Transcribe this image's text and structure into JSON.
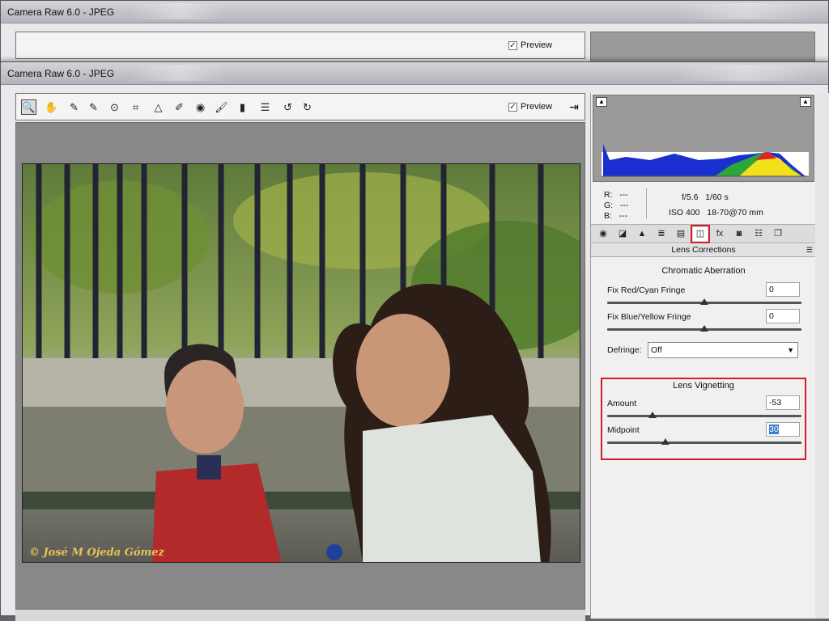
{
  "back_window": {
    "title": "Camera Raw 6.0  -  JPEG",
    "preview_label": "Preview",
    "preview_checked": true
  },
  "window": {
    "title": "Camera Raw 6.0  -  JPEG"
  },
  "toolbar": {
    "tools": [
      {
        "name": "zoom-tool-icon",
        "glyph": "🔍"
      },
      {
        "name": "hand-tool-icon",
        "glyph": "✋"
      },
      {
        "name": "white-balance-tool-icon",
        "glyph": "✎"
      },
      {
        "name": "color-sampler-tool-icon",
        "glyph": "✎"
      },
      {
        "name": "targeted-adjustment-tool-icon",
        "glyph": "⊙"
      },
      {
        "name": "crop-tool-icon",
        "glyph": "⌗"
      },
      {
        "name": "straighten-tool-icon",
        "glyph": "△"
      },
      {
        "name": "spot-removal-tool-icon",
        "glyph": "✐"
      },
      {
        "name": "red-eye-removal-tool-icon",
        "glyph": "◉"
      },
      {
        "name": "adjustment-brush-icon",
        "glyph": "🖌"
      },
      {
        "name": "graduated-filter-icon",
        "glyph": "▮"
      },
      {
        "name": "preferences-icon",
        "glyph": "☰"
      },
      {
        "name": "rotate-left-icon",
        "glyph": "↺"
      },
      {
        "name": "rotate-right-icon",
        "glyph": "↻"
      }
    ],
    "preview_label": "Preview",
    "preview_checked": true,
    "fullscreen_icon": "fullscreen-icon"
  },
  "photo": {
    "watermark": "© José M Ojeda Gómez"
  },
  "info": {
    "r": "R:   ---",
    "g": "G:   ---",
    "b": "B:   ---",
    "aperture": "f/5.6",
    "shutter": "1/60 s",
    "iso": "ISO 400",
    "lens": "18-70@70 mm"
  },
  "panel_tabs": [
    {
      "name": "tab-basic-icon",
      "glyph": "◉"
    },
    {
      "name": "tab-tone-curve-icon",
      "glyph": "◪"
    },
    {
      "name": "tab-detail-icon",
      "glyph": "▲"
    },
    {
      "name": "tab-hsl-icon",
      "glyph": "≣"
    },
    {
      "name": "tab-split-toning-icon",
      "glyph": "▤"
    },
    {
      "name": "tab-lens-corrections-icon",
      "glyph": "◫",
      "selected": true
    },
    {
      "name": "tab-effects-icon",
      "glyph": "fx"
    },
    {
      "name": "tab-camera-calibration-icon",
      "glyph": "◙"
    },
    {
      "name": "tab-presets-icon",
      "glyph": "☷"
    },
    {
      "name": "tab-snapshots-icon",
      "glyph": "❐"
    }
  ],
  "lens": {
    "section_title": "Lens Corrections",
    "chromatic_title": "Chromatic Aberration",
    "red_cyan_label": "Fix Red/Cyan Fringe",
    "red_cyan_value": "0",
    "red_cyan_level": 0.5,
    "blue_yellow_label": "Fix Blue/Yellow Fringe",
    "blue_yellow_value": "0",
    "blue_yellow_level": 0.5,
    "defringe_label": "Defringe:",
    "defringe_value": "Off",
    "vignetting_title": "Lens Vignetting",
    "amount_label": "Amount",
    "amount_value": "-53",
    "amount_level": 0.235,
    "midpoint_label": "Midpoint",
    "midpoint_value": "30",
    "midpoint_level": 0.3
  },
  "colors": {
    "highlight_red": "#cc1e2b",
    "selection_blue": "#3a7bd5"
  }
}
